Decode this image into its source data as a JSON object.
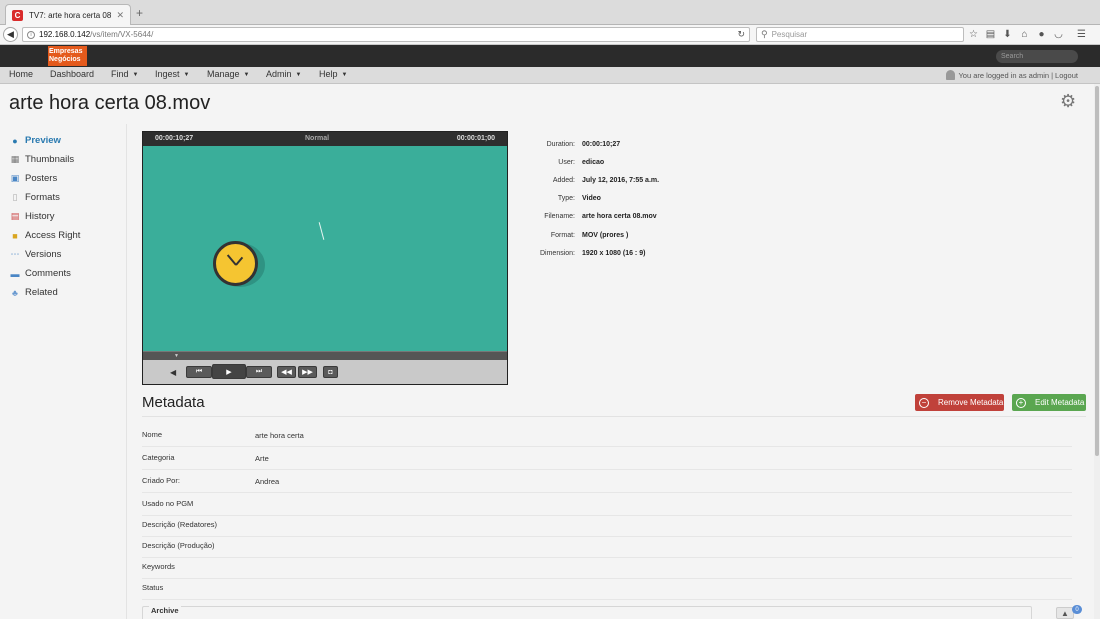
{
  "browser": {
    "tab_title": "TV7: arte hora certa 08.mov",
    "url_host": "192.168.0.142",
    "url_path": "/vs/item/VX-5644/",
    "search_placeholder": "Pesquisar"
  },
  "header": {
    "logo_line1": "Empresas",
    "logo_line2": "Negócios",
    "search_placeholder": "Search"
  },
  "menu": {
    "items": [
      "Home",
      "Dashboard",
      "Find",
      "Ingest",
      "Manage",
      "Admin",
      "Help"
    ],
    "login_text": "You are logged in as admin",
    "logout": "Logout"
  },
  "page": {
    "title": "arte hora certa 08.mov"
  },
  "sidebar": {
    "items": [
      {
        "label": "Preview",
        "icon": "preview-icon",
        "active": true
      },
      {
        "label": "Thumbnails",
        "icon": "thumbnails-icon"
      },
      {
        "label": "Posters",
        "icon": "posters-icon"
      },
      {
        "label": "Formats",
        "icon": "formats-icon"
      },
      {
        "label": "History",
        "icon": "history-icon"
      },
      {
        "label": "Access Right",
        "icon": "lock-icon"
      },
      {
        "label": "Versions",
        "icon": "versions-icon"
      },
      {
        "label": "Comments",
        "icon": "comments-icon"
      },
      {
        "label": "Related",
        "icon": "related-icon"
      }
    ]
  },
  "player": {
    "timecode_current": "00:00:10;27",
    "mode": "Normal",
    "timecode_right": "00:00:01;00"
  },
  "info": {
    "rows": [
      {
        "label": "Duration:",
        "value": "00:00:10;27"
      },
      {
        "label": "User:",
        "value": "edicao"
      },
      {
        "label": "Added:",
        "value": "July 12, 2016, 7:55 a.m."
      },
      {
        "label": "Type:",
        "value": "Video"
      },
      {
        "label": "Filename:",
        "value": "arte hora certa 08.mov"
      },
      {
        "label": "Format:",
        "value": "MOV (prores )"
      },
      {
        "label": "Dimension:",
        "value": "1920 x 1080 (16 : 9)"
      }
    ]
  },
  "metadata": {
    "heading": "Metadata",
    "remove_label": "Remove Metadata",
    "edit_label": "Edit Metadata",
    "rows": [
      {
        "label": "Nome",
        "value": "arte hora certa"
      },
      {
        "label": "Categoria",
        "value": "Arte"
      },
      {
        "label": "Criado Por:",
        "value": "Andrea"
      },
      {
        "label": "Usado no PGM",
        "value": ""
      },
      {
        "label": "Descrição (Redatores)",
        "value": ""
      },
      {
        "label": "Descrição (Produção)",
        "value": ""
      },
      {
        "label": "Keywords",
        "value": ""
      },
      {
        "label": "Status",
        "value": ""
      }
    ],
    "archive_label": "Archive"
  },
  "badge_count": "0",
  "colors": {
    "video_bg": "#3aae9a",
    "clock_face": "#f5c531",
    "remove_btn": "#c0413a",
    "edit_btn": "#5aa650",
    "active_link": "#2a7ab0"
  }
}
